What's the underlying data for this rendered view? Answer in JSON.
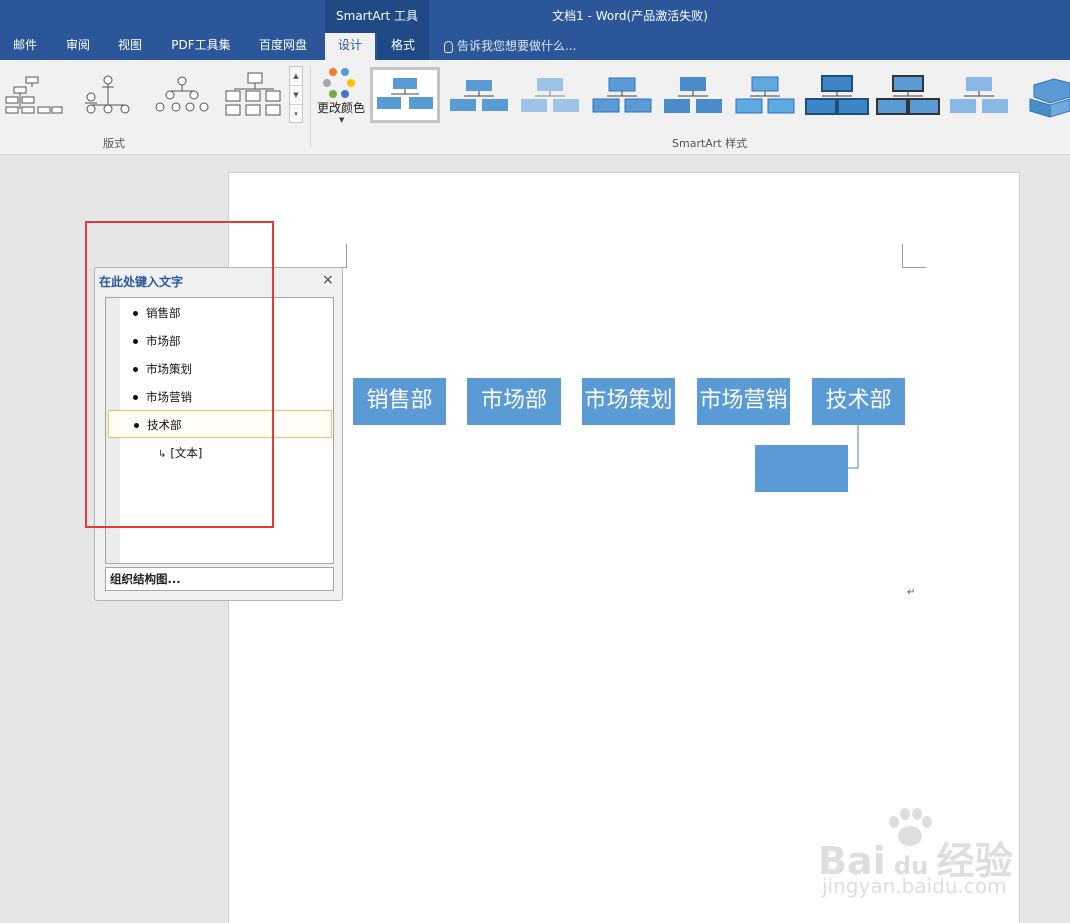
{
  "window": {
    "context_tool": "SmartArt 工具",
    "title": "文档1 - Word(产品激活失败)"
  },
  "tabs": [
    {
      "label": "邮件"
    },
    {
      "label": "审阅"
    },
    {
      "label": "视图"
    },
    {
      "label": "PDF工具集"
    },
    {
      "label": "百度网盘"
    },
    {
      "label": "设计",
      "active": true
    },
    {
      "label": "格式"
    }
  ],
  "tell_me": {
    "placeholder": "告诉我您想要做什么..."
  },
  "ribbon": {
    "layout_group_label": "版式",
    "styles_group_label": "SmartArt 样式",
    "change_colors_label": "更改颜色",
    "accent_color": "#5b9bd5"
  },
  "smartart": {
    "nodes": [
      "销售部",
      "市场部",
      "市场策划",
      "市场营销",
      "技术部"
    ],
    "child_node": ""
  },
  "text_pane": {
    "title": "在此处键入文字",
    "close_glyph": "×",
    "items": [
      "销售部",
      "市场部",
      "市场策划",
      "市场营销",
      "技术部"
    ],
    "selected_item": "技术部",
    "sub_item": "[文本]",
    "footer": "组织结构图..."
  },
  "watermark": {
    "logo": "Bai du 经验",
    "url": "jingyan.baidu.com"
  }
}
